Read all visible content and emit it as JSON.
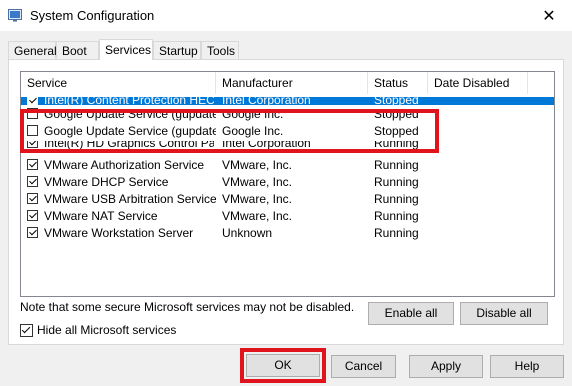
{
  "window": {
    "title": "System Configuration",
    "close_symbol": "✕"
  },
  "tabs": [
    {
      "label": "General"
    },
    {
      "label": "Boot"
    },
    {
      "label": "Services"
    },
    {
      "label": "Startup"
    },
    {
      "label": "Tools"
    }
  ],
  "active_tab": "Services",
  "columns": [
    "Service",
    "Manufacturer",
    "Status",
    "Date Disabled"
  ],
  "rows": [
    {
      "service": "Intel(R) Content Protection HEC...",
      "manufacturer": "Intel Corporation",
      "status": "Stopped",
      "checked": true,
      "selected": true
    },
    {
      "service": "Google Update Service (gupdate)",
      "manufacturer": "Google Inc.",
      "status": "Stopped",
      "checked": false,
      "selected": false
    },
    {
      "service": "Google Update Service (gupdatem)",
      "manufacturer": "Google Inc.",
      "status": "Stopped",
      "checked": false,
      "selected": false
    },
    {
      "service": "Intel(R) HD Graphics Control Pa...",
      "manufacturer": "Intel Corporation",
      "status": "Running",
      "checked": true,
      "selected": false
    },
    {
      "service": "VMware Authorization Service",
      "manufacturer": "VMware, Inc.",
      "status": "Running",
      "checked": true,
      "selected": false
    },
    {
      "service": "VMware DHCP Service",
      "manufacturer": "VMware, Inc.",
      "status": "Running",
      "checked": true,
      "selected": false
    },
    {
      "service": "VMware USB Arbitration Service",
      "manufacturer": "VMware, Inc.",
      "status": "Running",
      "checked": true,
      "selected": false
    },
    {
      "service": "VMware NAT Service",
      "manufacturer": "VMware, Inc.",
      "status": "Running",
      "checked": true,
      "selected": false
    },
    {
      "service": "VMware Workstation Server",
      "manufacturer": "Unknown",
      "status": "Running",
      "checked": true,
      "selected": false
    }
  ],
  "note": "Note that some secure Microsoft services may not be disabled.",
  "enable_all_label": "Enable all",
  "disable_all_label": "Disable all",
  "hide_ms_label": "Hide all Microsoft services",
  "hide_ms_checked": true,
  "buttons": {
    "ok": "OK",
    "cancel": "Cancel",
    "apply": "Apply",
    "help": "Help"
  },
  "colors": {
    "selection": "#0078d7",
    "highlight": "#e1141e"
  }
}
